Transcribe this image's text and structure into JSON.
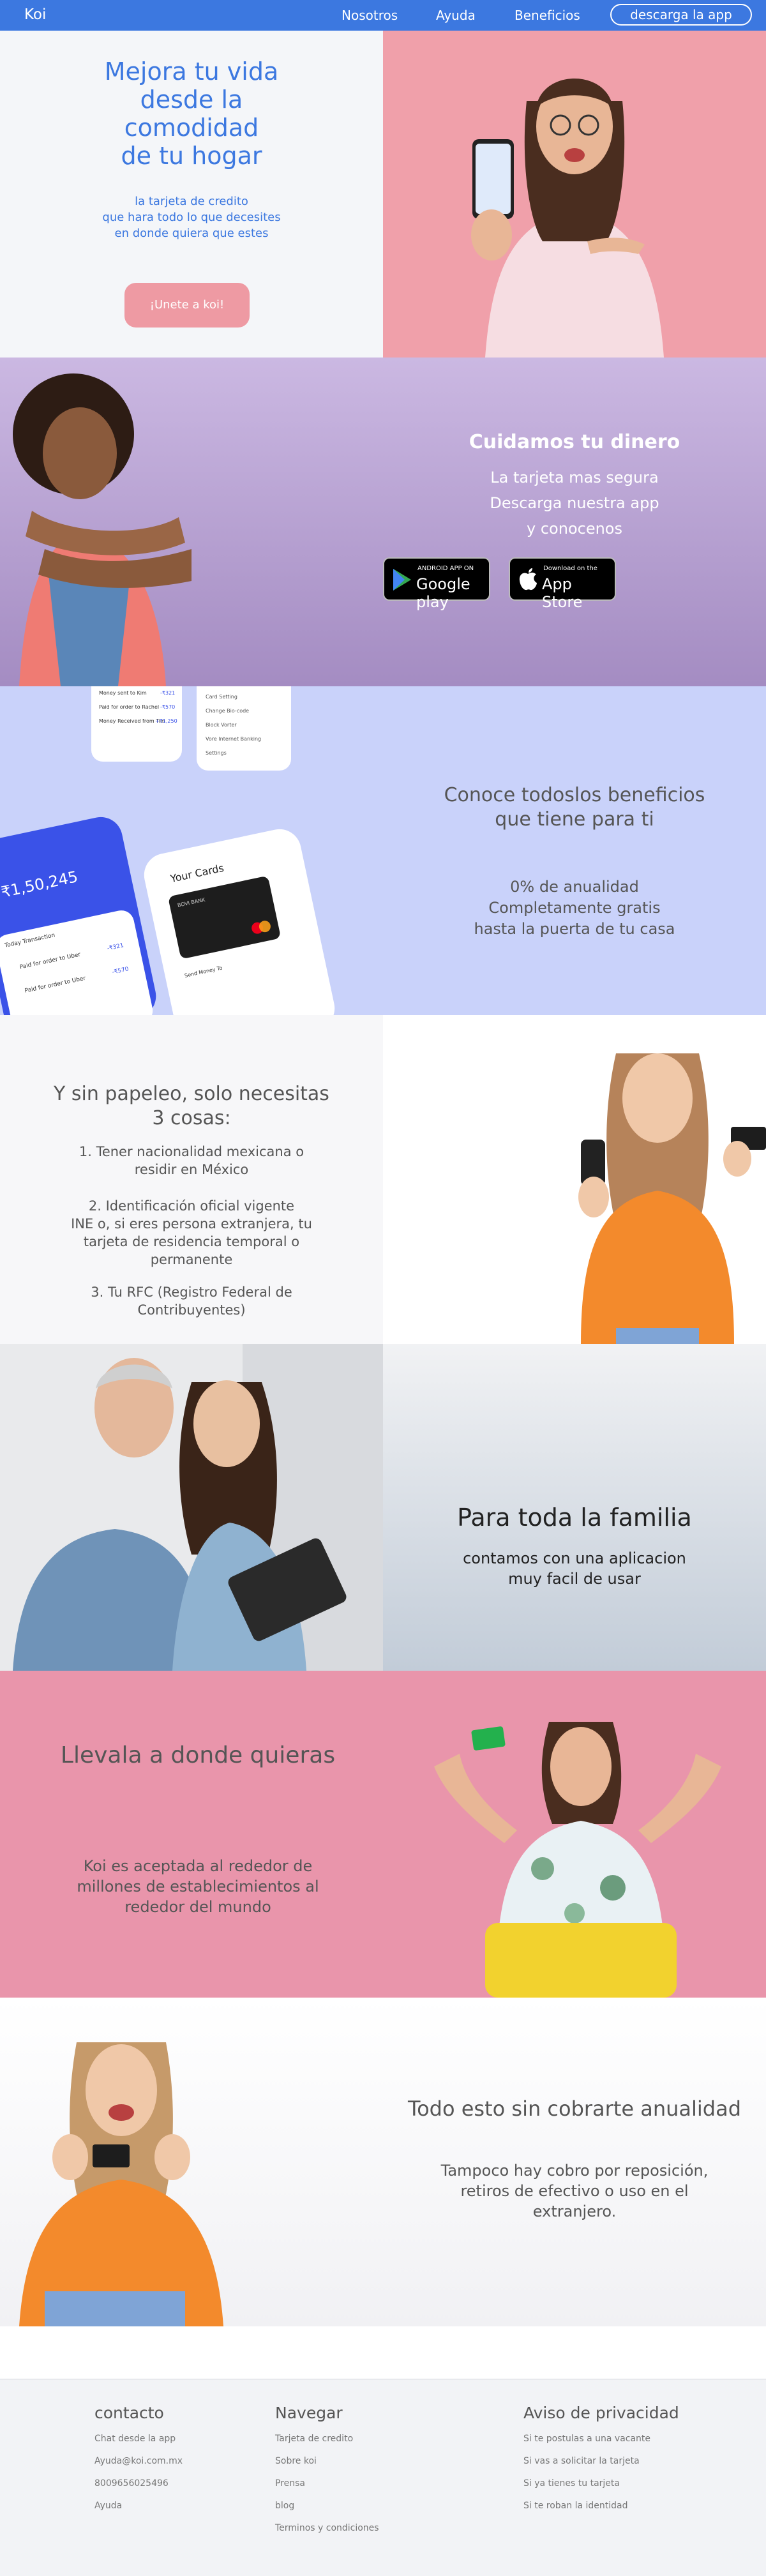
{
  "nav": {
    "brand": "Koi",
    "links": [
      "Nosotros",
      "Ayuda",
      "Beneficios"
    ],
    "cta": "descarga la app"
  },
  "hero": {
    "title_lines": [
      "Mejora tu vida",
      "desde la",
      "comodidad",
      "de tu hogar"
    ],
    "subtitle_lines": [
      "la tarjeta de credito",
      "que hara todo lo que decesites",
      "en donde quiera que estes"
    ],
    "button": "¡Unete a koi!",
    "colors": {
      "accent": "#3c78e0",
      "button": "#ee9aa3",
      "panel": "#f0a0aa"
    }
  },
  "money": {
    "title": "Cuidamos tu dinero",
    "lines": [
      "La tarjeta mas segura",
      "Descarga nuestra app",
      "y conocenos"
    ],
    "google": {
      "small": "ANDROID APP ON",
      "big": "Google play"
    },
    "apple": {
      "small": "Download on the",
      "big": "App Store"
    }
  },
  "benefits": {
    "title_lines": [
      "Conoce todoslos beneficios",
      "que tiene para ti"
    ],
    "lines": [
      "0% de anualidad",
      "Completamente gratis",
      "hasta la puerta de tu casa"
    ],
    "phone": {
      "balance": "₹1,50,245",
      "today": "Today Transaction",
      "cards_title": "Your Cards",
      "card_brand": "BOVI BANK",
      "send": "Send Money To",
      "tx": [
        {
          "label": "Paid for order to Uber",
          "amount": "-₹321"
        },
        {
          "label": "Paid for order to Uber",
          "amount": "-₹570"
        }
      ],
      "upper_rows": [
        "Money sent to Kim",
        "Paid for order to Rachel",
        "Money Received from Tim"
      ],
      "upper_amounts": [
        "-₹321",
        "-₹570",
        "+₹1,250"
      ],
      "menu": [
        "Card Setting",
        "Change Bio-code",
        "Block Vorter",
        "Vore Internet Banking",
        "Settings"
      ]
    }
  },
  "requirements": {
    "title_lines": [
      "Y sin papeleo, solo necesitas",
      "3 cosas:"
    ],
    "items": [
      [
        "1. Tener nacionalidad mexicana o",
        "residir en México"
      ],
      [
        "2. Identificación oficial vigente",
        "INE o, si eres persona extranjera, tu",
        "tarjeta de residencia temporal o",
        "permanente"
      ],
      [
        "3. Tu RFC (Registro Federal de",
        "Contribuyentes)"
      ]
    ]
  },
  "family": {
    "title": "Para toda la familia",
    "lines": [
      "contamos con una aplicacion",
      "muy facil de usar"
    ]
  },
  "anywhere": {
    "title": "Llevala a donde quieras",
    "lines": [
      "Koi es aceptada al rededor de",
      "millones de establecimientos al",
      "rededor del mundo"
    ]
  },
  "annual": {
    "title": "Todo esto sin cobrarte anualidad",
    "lines": [
      "Tampoco hay cobro por reposición,",
      "retiros de efectivo o uso en el",
      "extranjero."
    ]
  },
  "footer": {
    "contacto": {
      "title": "contacto",
      "items": [
        "Chat desde la app",
        "Ayuda@koi.com.mx",
        "8009656025496",
        "Ayuda"
      ]
    },
    "navegar": {
      "title": "Navegar",
      "items": [
        "Tarjeta de credito",
        "Sobre koi",
        "Prensa",
        "blog",
        "Terminos y condiciones"
      ]
    },
    "aviso": {
      "title": "Aviso de privacidad",
      "items": [
        "Si te postulas a una vacante",
        "Si vas a solicitar la tarjeta",
        "Si ya tienes tu tarjeta",
        "Si te roban la identidad"
      ]
    }
  }
}
